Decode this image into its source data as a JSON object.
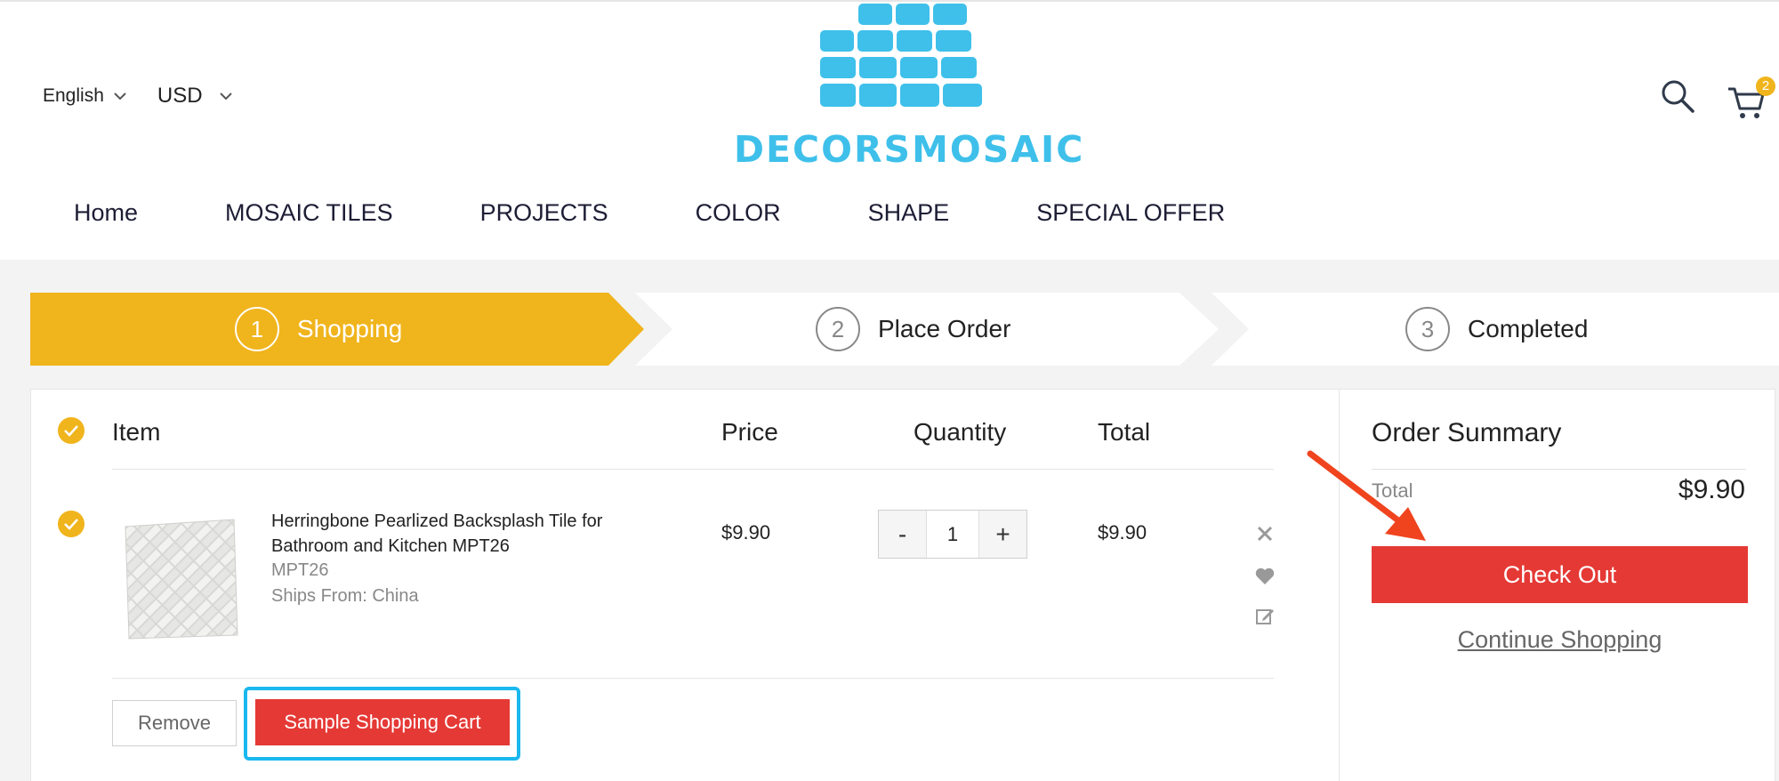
{
  "header": {
    "language": {
      "selected": "English"
    },
    "currency": {
      "selected": "USD"
    },
    "logo": {
      "text": "DECORSMOSAIC"
    },
    "icons": {
      "search": "search-icon",
      "cart": "cart-icon"
    },
    "cart_count": "2"
  },
  "nav": {
    "items": [
      "Home",
      "MOSAIC TILES",
      "PROJECTS",
      "COLOR",
      "SHAPE",
      "SPECIAL OFFER"
    ]
  },
  "steps": [
    {
      "number": "1",
      "label": "Shopping",
      "active": true
    },
    {
      "number": "2",
      "label": "Place Order",
      "active": false
    },
    {
      "number": "3",
      "label": "Completed",
      "active": false
    }
  ],
  "cart": {
    "columns": {
      "item": "Item",
      "price": "Price",
      "quantity": "Quantity",
      "total": "Total"
    },
    "items": [
      {
        "name": "Herringbone Pearlized Backsplash Tile for Bathroom and Kitchen MPT26",
        "sku": "MPT26",
        "ships_from": "Ships From: China",
        "price": "$9.90",
        "quantity": "1",
        "total": "$9.90",
        "selected": true
      }
    ],
    "qty_minus": "-",
    "qty_plus": "+",
    "remove_label": "Remove",
    "sample_label": "Sample Shopping Cart"
  },
  "summary": {
    "title": "Order Summary",
    "total_label": "Total",
    "total_value": "$9.90",
    "checkout_label": "Check Out",
    "continue_label": "Continue Shopping"
  },
  "colors": {
    "accent_yellow": "#f0b41c",
    "button_red": "#e53935",
    "logo_blue": "#3ec0ea",
    "highlight_blue": "#1ab8ee",
    "annotation_arrow": "#f0441f"
  }
}
